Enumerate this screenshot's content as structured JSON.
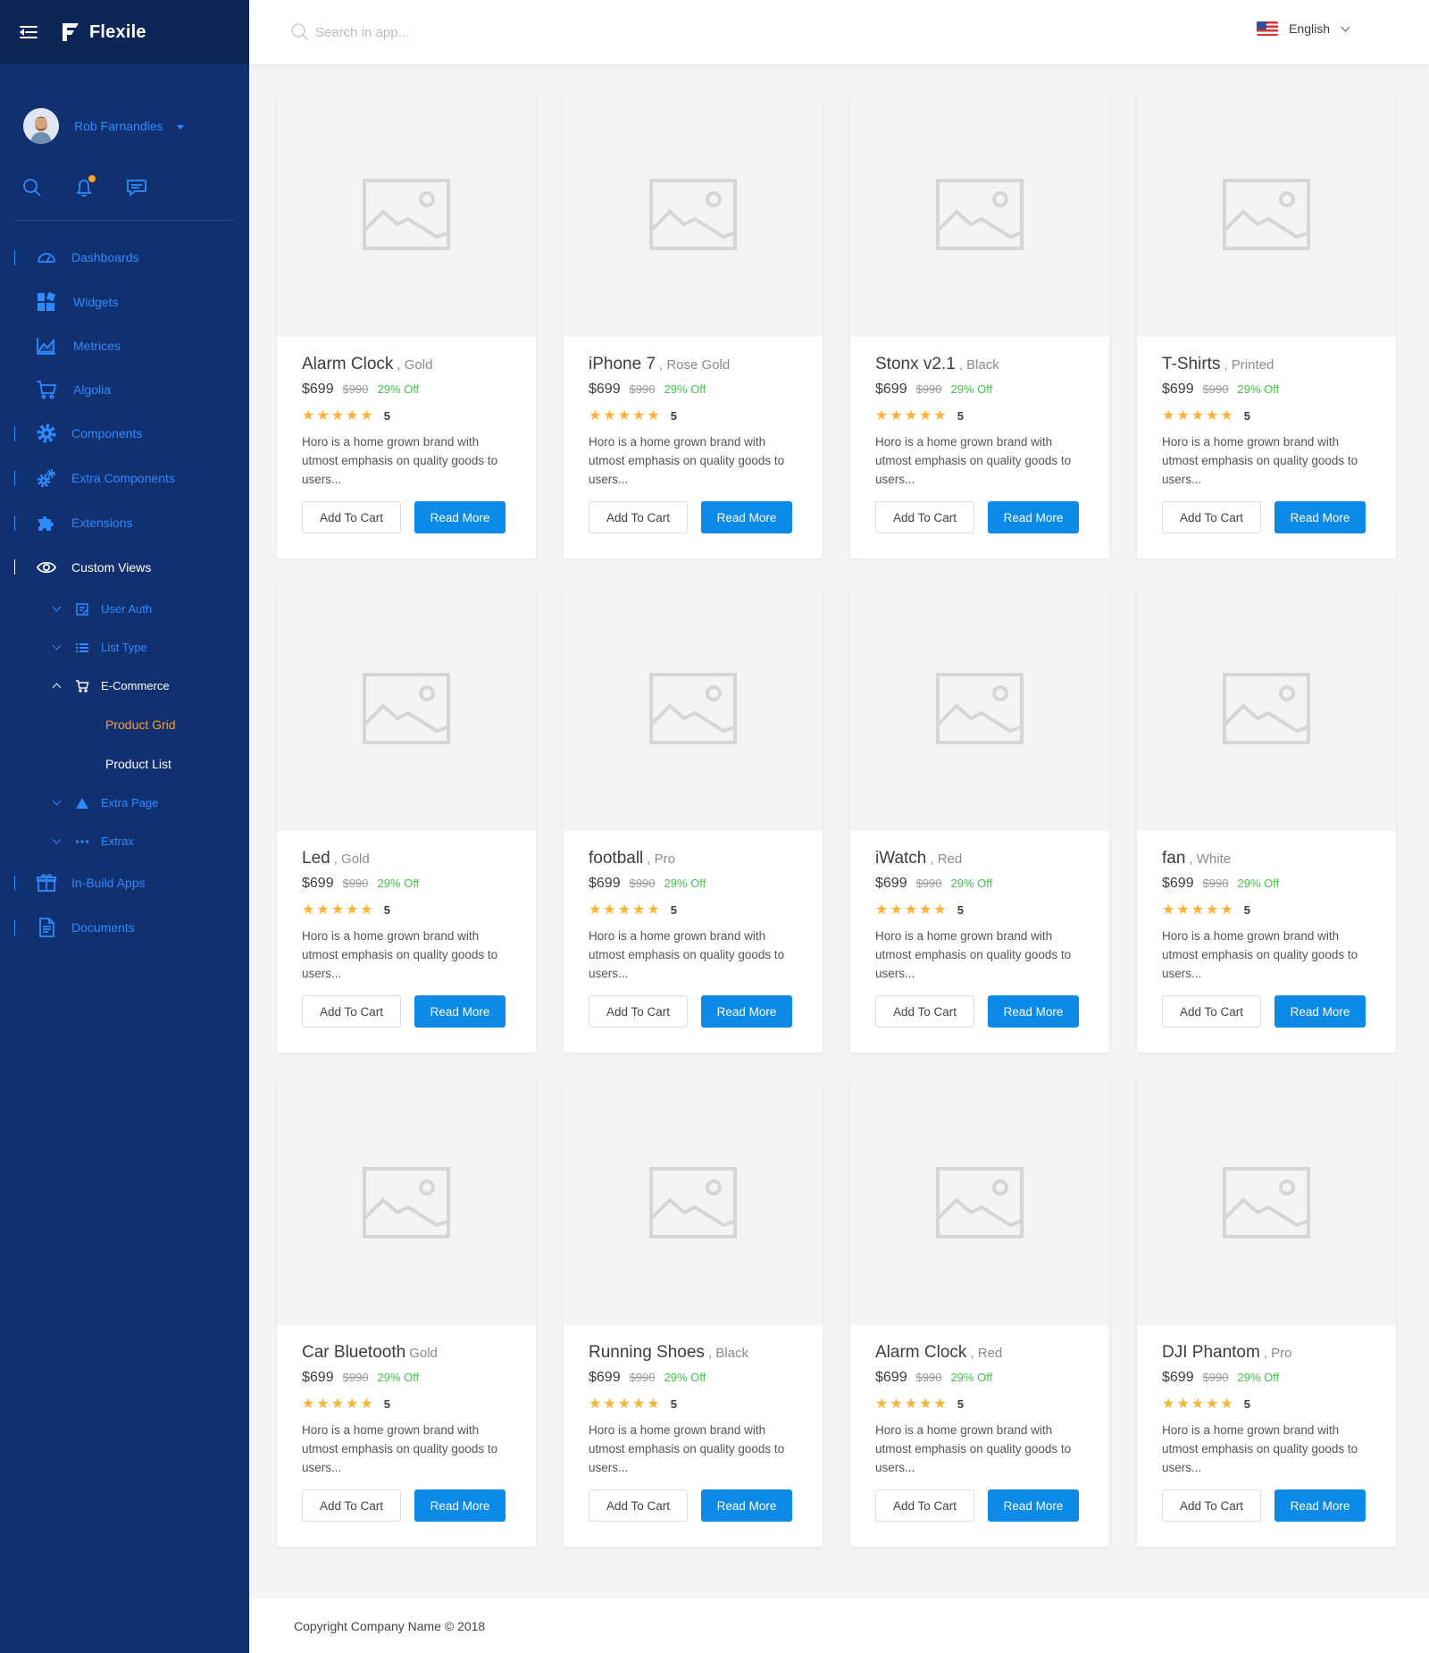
{
  "app": {
    "name": "Flexile"
  },
  "user": {
    "name": "Rob Farnandies"
  },
  "header": {
    "search_placeholder": "Search in app...",
    "language": "English"
  },
  "nav": {
    "dashboards": "Dashboards",
    "widgets": "Widgets",
    "metrices": "Metrices",
    "algolia": "Algolia",
    "components": "Components",
    "extra_components": "Extra Components",
    "extensions": "Extensions",
    "custom_views": "Custom Views",
    "user_auth": "User Auth",
    "list_type": "List Type",
    "ecommerce": "E-Commerce",
    "product_grid": "Product Grid",
    "product_list": "Product List",
    "extra_page": "Extra Page",
    "extrax": "Extrax",
    "inbuild_apps": "In-Build Apps",
    "documents": "Documents"
  },
  "products": [
    {
      "name": "Alarm Clock",
      "variant": ", Gold",
      "price": "$699",
      "old_price": "$990",
      "discount": "29% Off",
      "rating": "5",
      "stars": "★★★★★",
      "description": "Horo is a home grown brand with utmost emphasis on quality goods to users...",
      "cart_label": "Add To Cart",
      "more_label": "Read More"
    },
    {
      "name": "iPhone 7",
      "variant": ", Rose Gold",
      "price": "$699",
      "old_price": "$990",
      "discount": "29% Off",
      "rating": "5",
      "stars": "★★★★★",
      "description": "Horo is a home grown brand with utmost emphasis on quality goods to users...",
      "cart_label": "Add To Cart",
      "more_label": "Read More"
    },
    {
      "name": "Stonx v2.1",
      "variant": ", Black",
      "price": "$699",
      "old_price": "$990",
      "discount": "29% Off",
      "rating": "5",
      "stars": "★★★★★",
      "description": "Horo is a home grown brand with utmost emphasis on quality goods to users...",
      "cart_label": "Add To Cart",
      "more_label": "Read More"
    },
    {
      "name": "T-Shirts",
      "variant": ", Printed",
      "price": "$699",
      "old_price": "$990",
      "discount": "29% Off",
      "rating": "5",
      "stars": "★★★★★",
      "description": "Horo is a home grown brand with utmost emphasis on quality goods to users...",
      "cart_label": "Add To Cart",
      "more_label": "Read More"
    },
    {
      "name": "Led",
      "variant": ", Gold",
      "price": "$699",
      "old_price": "$990",
      "discount": "29% Off",
      "rating": "5",
      "stars": "★★★★★",
      "description": "Horo is a home grown brand with utmost emphasis on quality goods to users...",
      "cart_label": "Add To Cart",
      "more_label": "Read More"
    },
    {
      "name": "football",
      "variant": ", Pro",
      "price": "$699",
      "old_price": "$990",
      "discount": "29% Off",
      "rating": "5",
      "stars": "★★★★★",
      "description": "Horo is a home grown brand with utmost emphasis on quality goods to users...",
      "cart_label": "Add To Cart",
      "more_label": "Read More"
    },
    {
      "name": "iWatch",
      "variant": ", Red",
      "price": "$699",
      "old_price": "$990",
      "discount": "29% Off",
      "rating": "5",
      "stars": "★★★★★",
      "description": "Horo is a home grown brand with utmost emphasis on quality goods to users...",
      "cart_label": "Add To Cart",
      "more_label": "Read More"
    },
    {
      "name": "fan",
      "variant": ", White",
      "price": "$699",
      "old_price": "$990",
      "discount": "29% Off",
      "rating": "5",
      "stars": "★★★★★",
      "description": "Horo is a home grown brand with utmost emphasis on quality goods to users...",
      "cart_label": "Add To Cart",
      "more_label": "Read More"
    },
    {
      "name": "Car Bluetooth",
      "variant": "Gold",
      "price": "$699",
      "old_price": "$990",
      "discount": "29% Off",
      "rating": "5",
      "stars": "★★★★★",
      "description": "Horo is a home grown brand with utmost emphasis on quality goods to users...",
      "cart_label": "Add To Cart",
      "more_label": "Read More"
    },
    {
      "name": "Running Shoes",
      "variant": ", Black",
      "price": "$699",
      "old_price": "$990",
      "discount": "29% Off",
      "rating": "5",
      "stars": "★★★★★",
      "description": "Horo is a home grown brand with utmost emphasis on quality goods to users...",
      "cart_label": "Add To Cart",
      "more_label": "Read More"
    },
    {
      "name": "Alarm Clock",
      "variant": ", Red",
      "price": "$699",
      "old_price": "$990",
      "discount": "29% Off",
      "rating": "5",
      "stars": "★★★★★",
      "description": "Horo is a home grown brand with utmost emphasis on quality goods to users...",
      "cart_label": "Add To Cart",
      "more_label": "Read More"
    },
    {
      "name": "DJI Phantom",
      "variant": ", Pro",
      "price": "$699",
      "old_price": "$990",
      "discount": "29% Off",
      "rating": "5",
      "stars": "★★★★★",
      "description": "Horo is a home grown brand with utmost emphasis on quality goods to users...",
      "cart_label": "Add To Cart",
      "more_label": "Read More"
    }
  ],
  "footer": {
    "copyright": "Copyright Company Name © 2018"
  },
  "colors": {
    "sidebar_bg": "#11306f",
    "brand_bg": "#0e2657",
    "accent": "#2e8bff",
    "active": "#ff9b2b",
    "primary_button": "#0c8ae8",
    "star": "#ffb236",
    "discount": "#46c34c"
  },
  "icons": [
    "menu-icon",
    "flexile-logo",
    "search-icon",
    "bell-icon",
    "chat-icon",
    "dashboard-icon",
    "widgets-icon",
    "chart-icon",
    "cart-icon",
    "gear-icon",
    "gears-icon",
    "puzzle-icon",
    "eye-icon",
    "form-icon",
    "list-icon",
    "triangle-icon",
    "dots-icon",
    "gift-icon",
    "document-icon",
    "image-placeholder-icon",
    "us-flag-icon",
    "chevron-down-icon"
  ]
}
